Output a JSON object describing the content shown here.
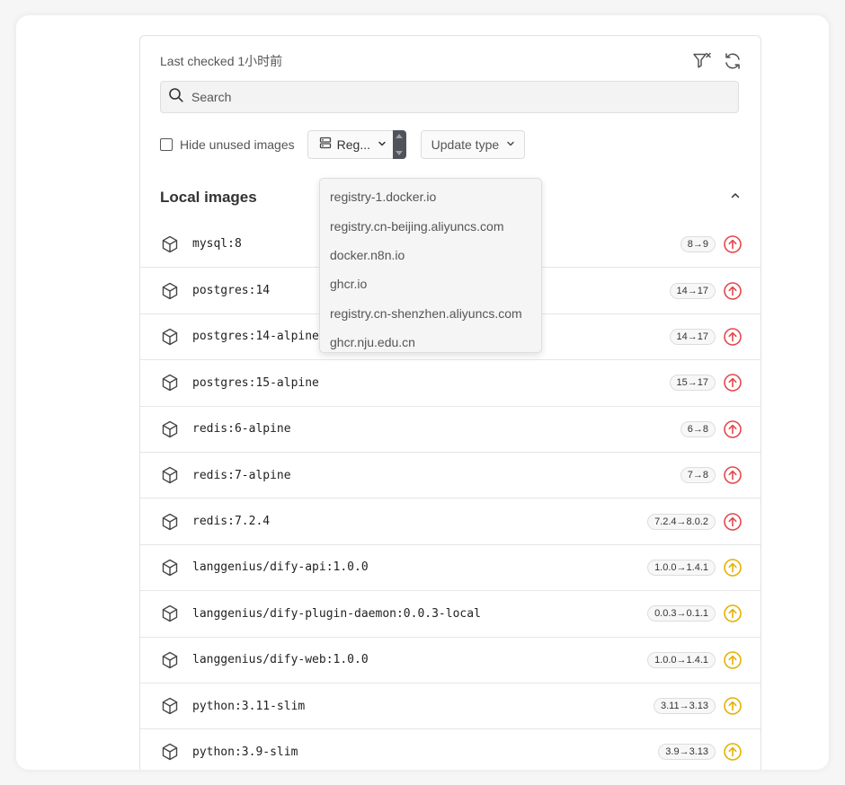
{
  "header": {
    "last_checked": "Last checked 1小时前",
    "filter_icon": "filter-x-icon",
    "refresh_icon": "refresh-icon"
  },
  "search": {
    "placeholder": "Search",
    "value": ""
  },
  "filters": {
    "hide_unused_label": "Hide unused images",
    "hide_unused_checked": false,
    "registry_label": "Reg...",
    "update_type_label": "Update type"
  },
  "registry_options": [
    "registry-1.docker.io",
    "registry.cn-beijing.aliyuncs.com",
    "docker.n8n.io",
    "ghcr.io",
    "registry.cn-shenzhen.aliyuncs.com",
    "ghcr.nju.edu.cn"
  ],
  "section": {
    "title": "Local images"
  },
  "colors": {
    "major": "#e5484d",
    "minor": "#e5b100"
  },
  "images": [
    {
      "name": "mysql:8",
      "badge": "8→9",
      "status": "major"
    },
    {
      "name": "postgres:14",
      "badge": "14→17",
      "status": "major"
    },
    {
      "name": "postgres:14-alpine",
      "badge": "14→17",
      "status": "major"
    },
    {
      "name": "postgres:15-alpine",
      "badge": "15→17",
      "status": "major"
    },
    {
      "name": "redis:6-alpine",
      "badge": "6→8",
      "status": "major"
    },
    {
      "name": "redis:7-alpine",
      "badge": "7→8",
      "status": "major"
    },
    {
      "name": "redis:7.2.4",
      "badge": "7.2.4→8.0.2",
      "status": "major"
    },
    {
      "name": "langgenius/dify-api:1.0.0",
      "badge": "1.0.0→1.4.1",
      "status": "minor"
    },
    {
      "name": "langgenius/dify-plugin-daemon:0.0.3-local",
      "badge": "0.0.3→0.1.1",
      "status": "minor"
    },
    {
      "name": "langgenius/dify-web:1.0.0",
      "badge": "1.0.0→1.4.1",
      "status": "minor"
    },
    {
      "name": "python:3.11-slim",
      "badge": "3.11→3.13",
      "status": "minor"
    },
    {
      "name": "python:3.9-slim",
      "badge": "3.9→3.13",
      "status": "minor"
    }
  ]
}
